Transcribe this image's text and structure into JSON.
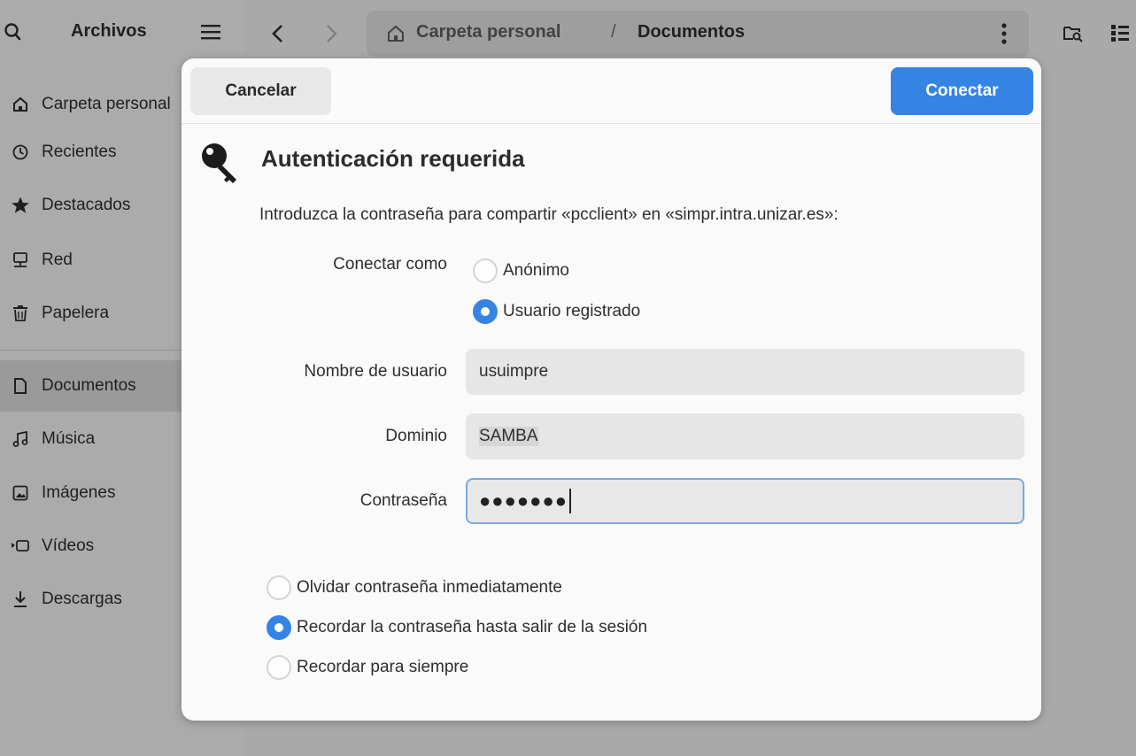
{
  "app": {
    "title": "Archivos",
    "sidebar": {
      "items": [
        {
          "label": "Carpeta personal",
          "icon": "home-icon"
        },
        {
          "label": "Recientes",
          "icon": "clock-icon"
        },
        {
          "label": "Destacados",
          "icon": "star-icon"
        },
        {
          "label": "Red",
          "icon": "network-icon"
        },
        {
          "label": "Papelera",
          "icon": "trash-icon"
        },
        {
          "label": "Documentos",
          "icon": "document-icon",
          "active": true
        },
        {
          "label": "Música",
          "icon": "music-icon"
        },
        {
          "label": "Imágenes",
          "icon": "image-icon"
        },
        {
          "label": "Vídeos",
          "icon": "video-icon"
        },
        {
          "label": "Descargas",
          "icon": "download-icon"
        }
      ]
    },
    "pathbar": {
      "root": "Carpeta personal",
      "separator": "/",
      "current": "Documentos"
    }
  },
  "dialog": {
    "cancel_label": "Cancelar",
    "connect_label": "Conectar",
    "title": "Autenticación requerida",
    "message": "Introduzca la contraseña para compartir «pcclient» en «simpr.intra.unizar.es»:",
    "connect_as": {
      "label": "Conectar como",
      "options": [
        {
          "label": "Anónimo",
          "checked": false
        },
        {
          "label": "Usuario registrado",
          "checked": true
        }
      ]
    },
    "username": {
      "label": "Nombre de usuario",
      "value": "usuimpre"
    },
    "domain": {
      "label": "Dominio",
      "value": "SAMBA"
    },
    "password": {
      "label": "Contraseña",
      "masked": "●●●●●●●"
    },
    "remember": {
      "options": [
        {
          "label": "Olvidar contraseña inmediatamente",
          "checked": false
        },
        {
          "label": "Recordar la contraseña hasta salir de la sesión",
          "checked": true
        },
        {
          "label": "Recordar para siempre",
          "checked": false
        }
      ]
    }
  },
  "colors": {
    "accent": "#3584e4",
    "backdrop": "#a9a9a9",
    "dialog_bg": "#fafafa"
  }
}
